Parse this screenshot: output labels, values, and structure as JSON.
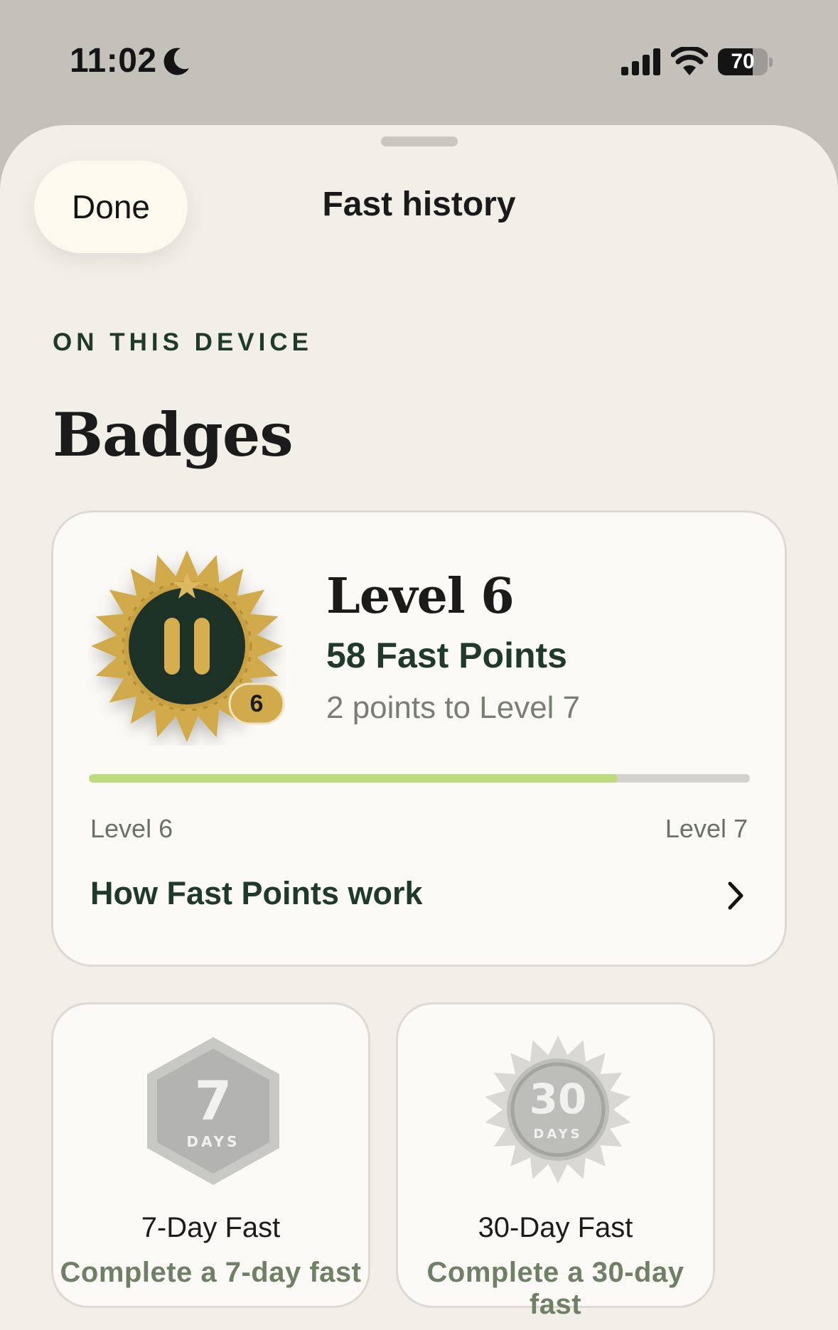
{
  "status_bar": {
    "time": "11:02",
    "focus_icon": "moon-icon",
    "signal_icon": "cellular-signal-icon",
    "wifi_icon": "wifi-icon",
    "battery_percent": "70",
    "battery_level": 0.7
  },
  "header": {
    "done_label": "Done",
    "title": "Fast history"
  },
  "section": {
    "eyebrow": "ON THIS DEVICE",
    "title": "Badges"
  },
  "level_card": {
    "badge_icon": "pause-starburst-badge-icon",
    "badge_number": "6",
    "title": "Level 6",
    "points": "58 Fast Points",
    "remaining": "2 points to Level 7",
    "progress": 0.8,
    "progress_start_label": "Level 6",
    "progress_end_label": "Level 7",
    "link_label": "How Fast Points work",
    "link_icon": "chevron-right-icon"
  },
  "badges": [
    {
      "icon": "hexagon-badge-icon",
      "number": "7",
      "unit": "DAYS",
      "name": "7-Day Fast",
      "description": "Complete a 7-day fast"
    },
    {
      "icon": "starburst-badge-icon",
      "number": "30",
      "unit": "DAYS",
      "name": "30-Day Fast",
      "description": "Complete a 30-day fast"
    }
  ],
  "colors": {
    "accent_green": "#1f3a2a",
    "progress_green": "#bedb7e",
    "gold": "#d1aa4b",
    "sheet_background": "#f1efe8"
  }
}
